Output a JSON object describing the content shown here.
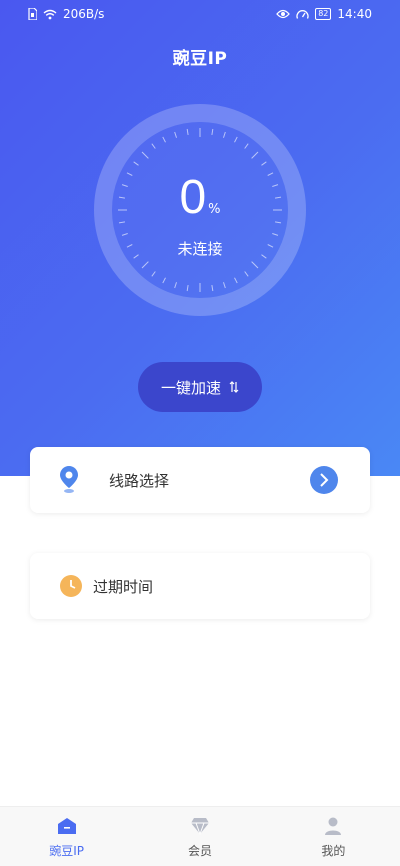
{
  "status_bar": {
    "speed": "206B/s",
    "battery": "82",
    "time": "14:40"
  },
  "header": {
    "title": "豌豆IP"
  },
  "dial": {
    "percent": "0",
    "unit": "%",
    "status": "未连接"
  },
  "boost": {
    "label": "一键加速"
  },
  "cards": {
    "route_label": "线路选择",
    "expire_label": "过期时间"
  },
  "bottom_nav": {
    "items": [
      {
        "label": "豌豆IP",
        "icon": "home-icon"
      },
      {
        "label": "会员",
        "icon": "diamond-icon"
      },
      {
        "label": "我的",
        "icon": "user-icon"
      }
    ]
  },
  "colors": {
    "primary": "#4a6cf1",
    "button_dark": "#3b46cc",
    "pin": "#4f86ec",
    "clock": "#f5b55a"
  }
}
